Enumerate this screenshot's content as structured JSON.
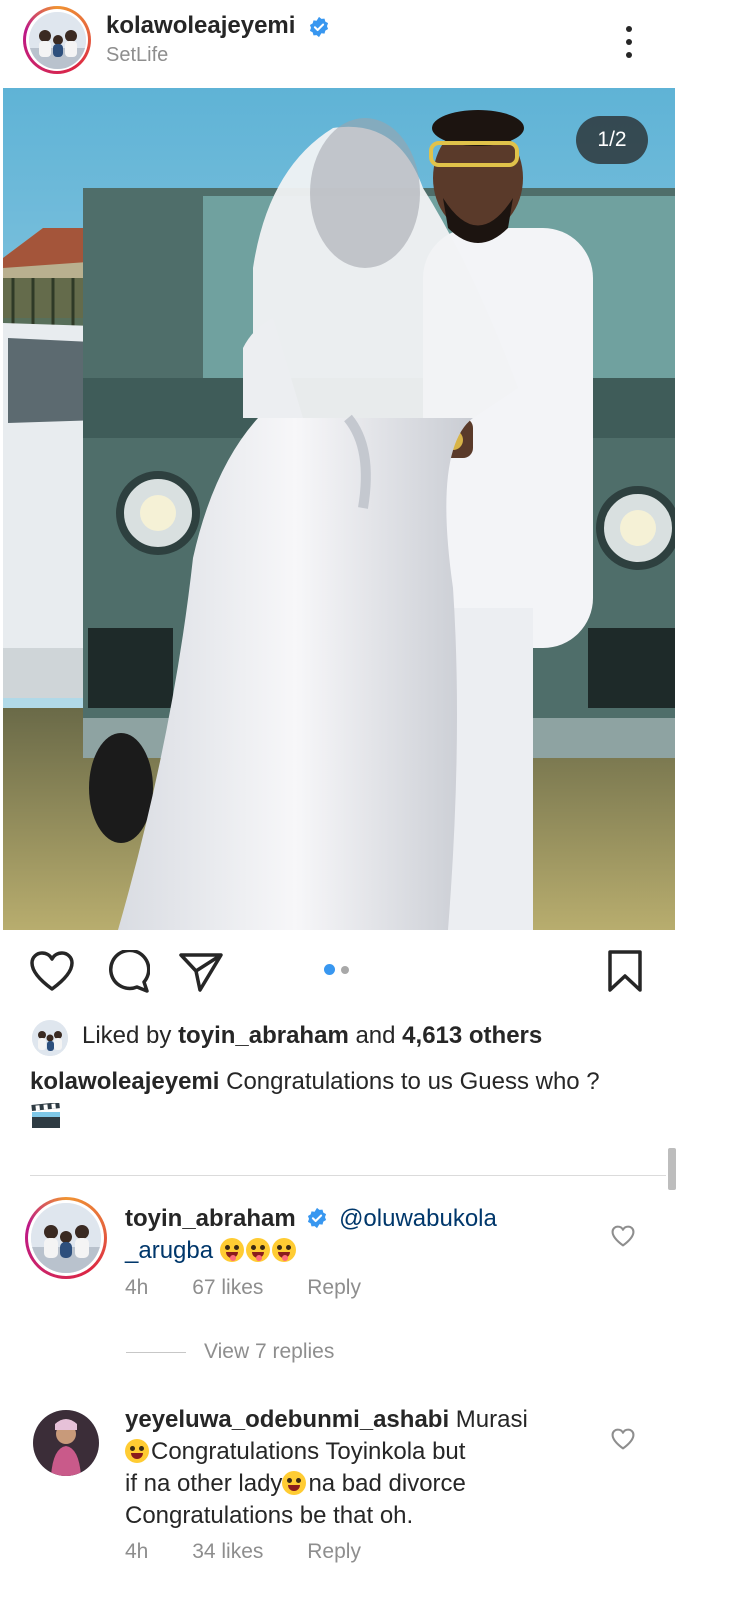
{
  "post": {
    "username": "kolawoleajeyemi",
    "location": "SetLife",
    "photo_counter": "1/2",
    "liked_by_prefix": "Liked by",
    "liked_by_user": "toyin_abraham",
    "liked_by_and": "and",
    "liked_by_others": "4,613 others",
    "caption_user": "kolawoleajeyemi",
    "caption_text": "Congratulations to us Guess who ?",
    "caption_emoji": "clapper-board-emoji"
  },
  "comments": [
    {
      "user": "toyin_abraham",
      "verified": true,
      "mention": "@oluwabukola",
      "mention_cont": "_arugba",
      "time": "4h",
      "likes": "67 likes",
      "reply": "Reply",
      "view_replies": "View 7 replies"
    },
    {
      "user": "yeyeluwa_odebunmi_ashabi",
      "verified": false,
      "text_1": "Murasi",
      "text_2": "Congratulations Toyinkola but",
      "text_3": "if na other lady",
      "text_4": "na bad divorce",
      "text_5": "Congratulations be that oh.",
      "time": "4h",
      "likes": "34 likes",
      "reply": "Reply"
    }
  ],
  "colors": {
    "verified_blue": "#3897f0",
    "dot_active": "#3897f0",
    "dot_inactive": "#a8a8a8",
    "text_secondary": "#8e8e8e",
    "mention": "#00376b"
  }
}
